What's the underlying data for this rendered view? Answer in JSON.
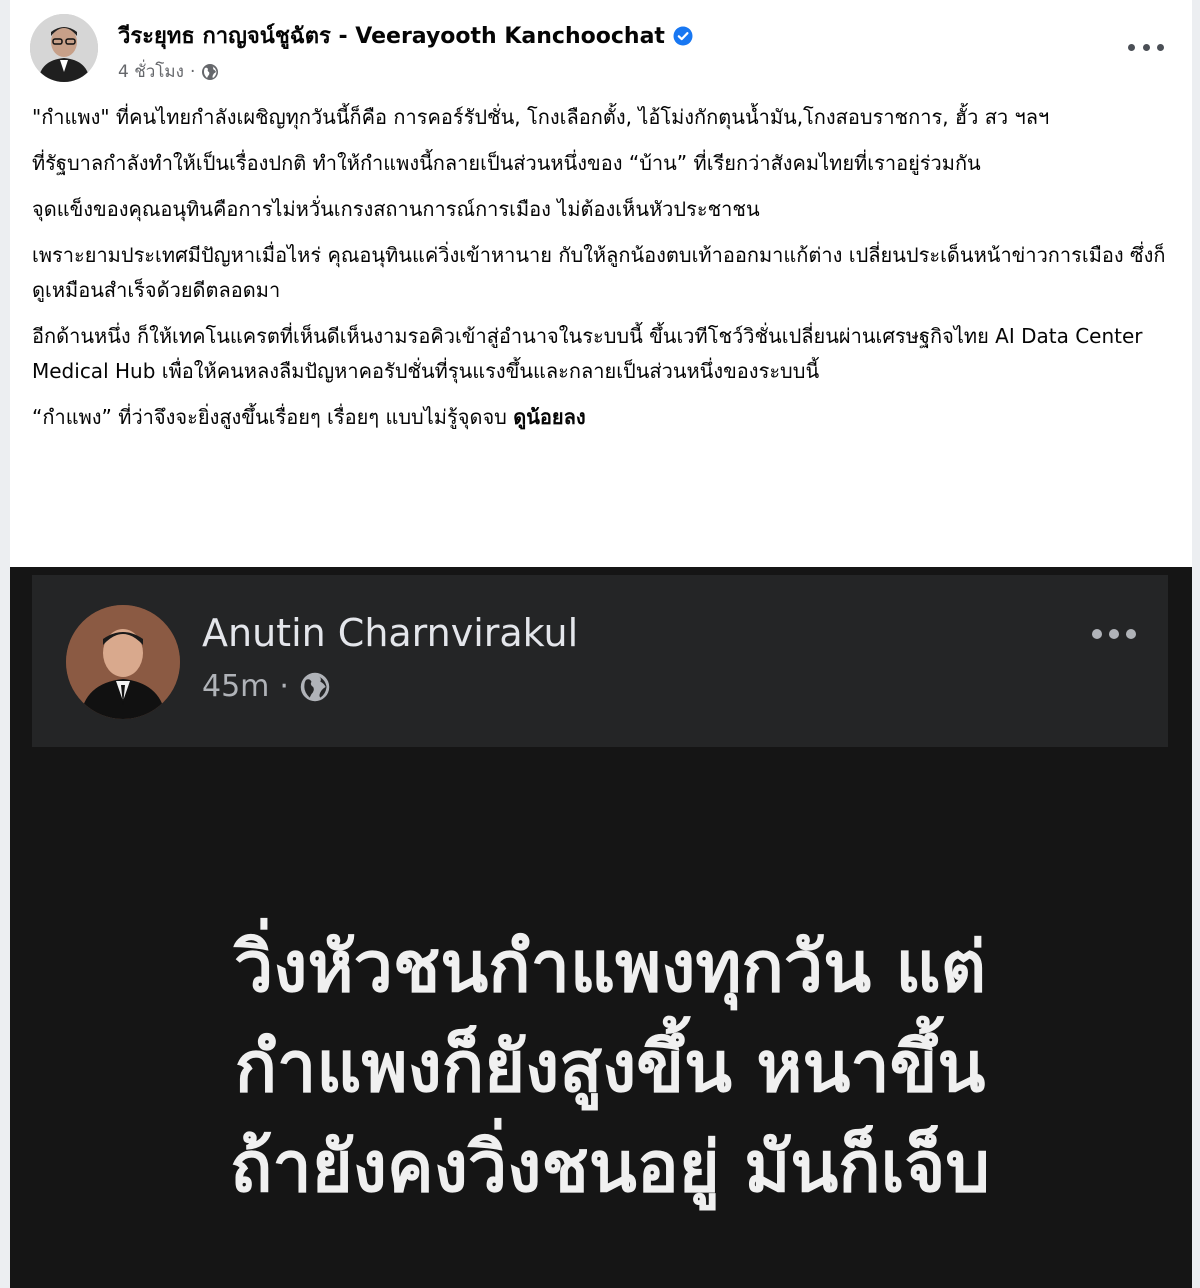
{
  "post": {
    "author": "วีระยุทธ กาญจน์ชูฉัตร - Veerayooth Kanchoochat",
    "time": "4 ชั่วโมง",
    "privacy_dot": "·",
    "paragraphs": [
      "\"กำแพง\" ที่คนไทยกำลังเผชิญทุกวันนี้ก็คือ การคอร์รัปชั่น, ￼โกงเลือกตั้ง, ไอ้โม่งกักตุนน้ำมัน,￼โกงสอบราชการ, ฮั้ว สว ฯลฯ",
      "ที่รัฐบาลกำลังทำให้เป็นเรื่องปกติ ทำให้กำแพงนี้กลายเป็นส่วนหนึ่งของ “บ้าน” ที่เรียกว่าสังคมไทยที่เราอยู่ร่วมกัน",
      "จุดแข็งของคุณอนุทินคือการไม่หวั่นเกรงสถานการณ์การเมือง ไม่ต้องเห็นหัวประชาชน",
      "เพราะยามประเทศมีปัญหาเมื่อไหร่ คุณอนุทินแค่วิ่งเข้าหานาย กับให้ลูกน้องตบเท้าออกมาแก้ต่าง เปลี่ยนประเด็นหน้าข่าวการเมือง ซึ่งก็ดูเหมือนสำเร็จด้วยดีตลอดมา ￼",
      "อีกด้านหนึ่ง ก็ให้เทคโนแครตที่เห็นดีเห็นงามรอคิวเข้าสู่อำนาจในระบบนี้ ขึ้นเวทีโชว์วิชั่นเปลี่ยนผ่านเศรษฐกิจไทย ￼AI Data Center Medical Hub เพื่อให้คนหลงลืม￼ปัญหาคอรัปชั่นที่รุนแรงขึ้นและกลายเป็นส่วนหนึ่งของระบบนี้"
    ],
    "last_paragraph_main": "“กำแพง” ที่ว่าจึงจะยิ่งสูงขึ้นเรื่อยๆ เรื่อยๆ แบบไม่รู้จุดจบ ",
    "last_paragraph_bold": "ดูน้อยลง"
  },
  "embedded": {
    "author": "Anutin Charnvirakul",
    "time": "45m",
    "dot": "·",
    "quote_lines": [
      "วิ่งหัวชนกำแพงทุกวัน แต่",
      "กำแพงก็ยังสูงขึ้น หนาขึ้น",
      "ถ้ายังคงวิ่งชนอยู่ มันก็เจ็บ"
    ]
  },
  "colors": {
    "verified": "#1877f2",
    "meta": "#65676b",
    "embed_bg": "#151515"
  },
  "icons": {
    "verified": "verified-badge-icon",
    "globe": "globe-icon",
    "more": "more-options-icon"
  }
}
